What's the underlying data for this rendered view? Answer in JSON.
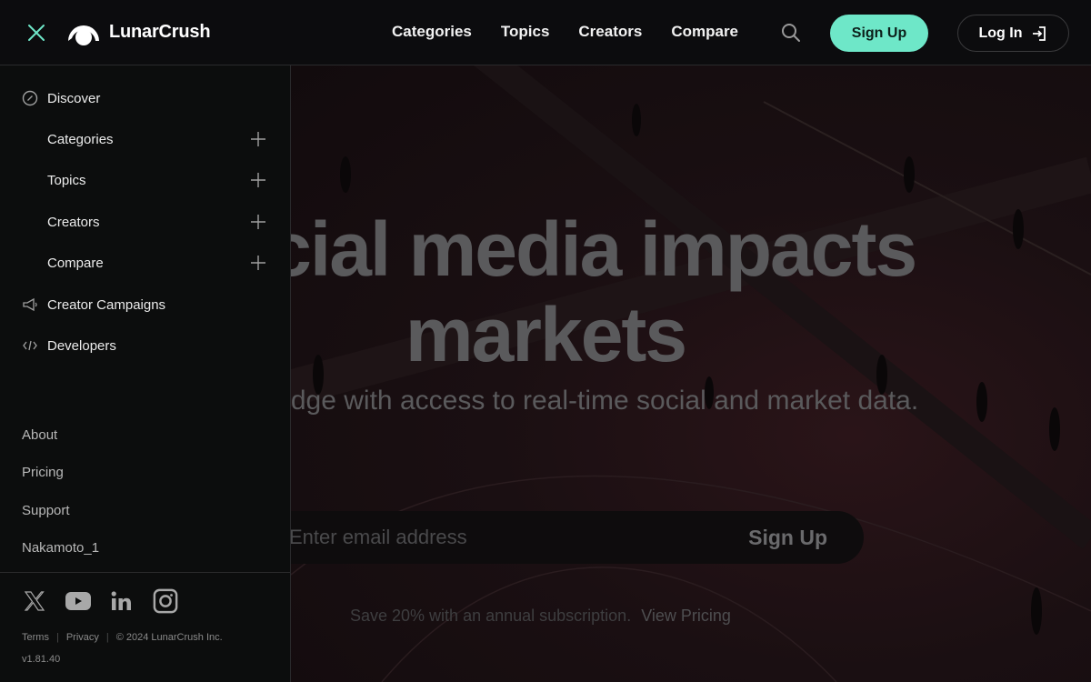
{
  "header": {
    "brand": "LunarCrush",
    "nav": [
      {
        "label": "Categories"
      },
      {
        "label": "Topics"
      },
      {
        "label": "Creators"
      },
      {
        "label": "Compare"
      }
    ],
    "signup_label": "Sign Up",
    "login_label": "Log In",
    "accent_color": "#6ee7c8"
  },
  "sidebar": {
    "main": [
      {
        "label": "Discover",
        "icon": "compass-icon"
      },
      {
        "label": "Categories",
        "expandable": true
      },
      {
        "label": "Topics",
        "expandable": true
      },
      {
        "label": "Creators",
        "expandable": true
      },
      {
        "label": "Compare",
        "expandable": true
      },
      {
        "label": "Creator Campaigns",
        "icon": "megaphone-icon"
      },
      {
        "label": "Developers",
        "icon": "code-icon"
      }
    ],
    "secondary": [
      {
        "label": "About"
      },
      {
        "label": "Pricing"
      },
      {
        "label": "Support"
      },
      {
        "label": "Nakamoto_1"
      }
    ],
    "socials": [
      "x-icon",
      "youtube-icon",
      "linkedin-icon",
      "instagram-icon"
    ],
    "legal": {
      "terms": "Terms",
      "privacy": "Privacy",
      "copyright": "© 2024 LunarCrush Inc."
    },
    "version": "v1.81.40"
  },
  "hero": {
    "title_line1": "Social media impacts",
    "title_line2": "markets",
    "subtitle": "Gain an edge with access to real-time social and market data.",
    "email_placeholder": "Enter email address",
    "signup_label": "Sign Up",
    "promo_text": "Save 20% with an annual subscription.",
    "promo_link": "View Pricing"
  }
}
